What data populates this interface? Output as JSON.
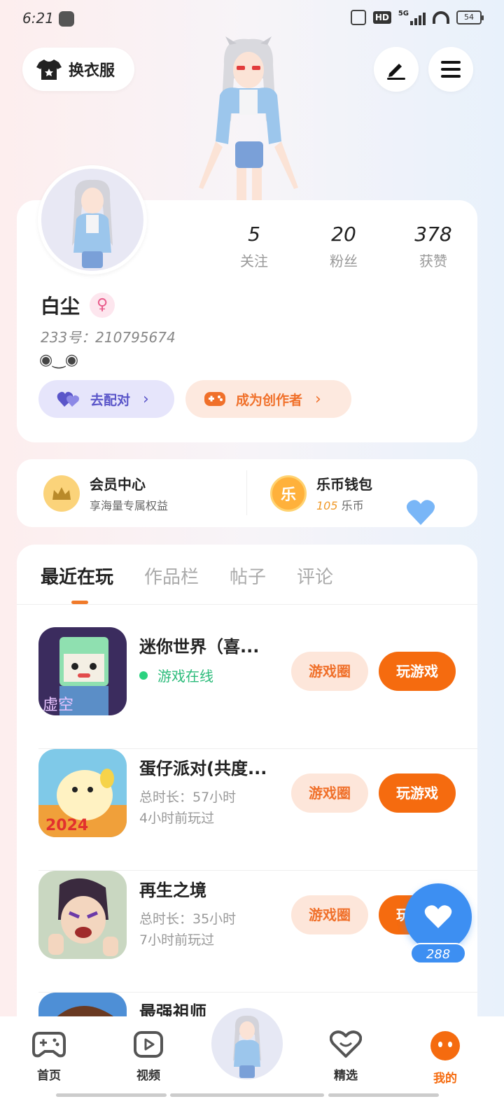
{
  "status_bar": {
    "time": "6:21",
    "network": "5G",
    "hd": "HD",
    "battery": "54"
  },
  "header": {
    "change_clothes_label": "换衣服"
  },
  "profile": {
    "stats": [
      {
        "value": "5",
        "label": "关注"
      },
      {
        "value": "20",
        "label": "粉丝"
      },
      {
        "value": "378",
        "label": "获赞"
      }
    ],
    "username": "白尘",
    "gender_symbol": "♀",
    "user_id": "233号：210795674",
    "bio": "◉‿◉",
    "match_label": "去配对",
    "creator_label": "成为创作者"
  },
  "wallet": {
    "vip_title": "会员中心",
    "vip_sub": "享海量专属权益",
    "coin_title": "乐币钱包",
    "coin_icon_char": "乐",
    "coin_amount": "105",
    "coin_unit": "乐币"
  },
  "tabs": [
    "最近在玩",
    "作品栏",
    "帖子",
    "评论"
  ],
  "games": [
    {
      "title": "迷你世界（喜...",
      "status": "游戏在线",
      "circle_label": "游戏圈",
      "play_label": "玩游戏"
    },
    {
      "title": "蛋仔派对(共度...",
      "total_time": "总时长：57小时",
      "last_played": "4小时前玩过",
      "circle_label": "游戏圈",
      "play_label": "玩游戏"
    },
    {
      "title": "再生之境",
      "total_time": "总时长：35小时",
      "last_played": "7小时前玩过",
      "circle_label": "游戏圈",
      "play_label": "玩游戏"
    },
    {
      "title": "最强祖师"
    }
  ],
  "fab": {
    "count": "288"
  },
  "bottom_nav": [
    {
      "label": "首页",
      "icon": "gamepad-icon"
    },
    {
      "label": "视频",
      "icon": "video-play-icon"
    },
    {
      "label": "精选",
      "icon": "heart-chat-icon"
    },
    {
      "label": "我的",
      "icon": "face-icon"
    }
  ],
  "colors": {
    "accent": "#f56b0f",
    "blue": "#3d8ff2",
    "purple": "#5a55c9",
    "online": "#2bbb7a"
  }
}
